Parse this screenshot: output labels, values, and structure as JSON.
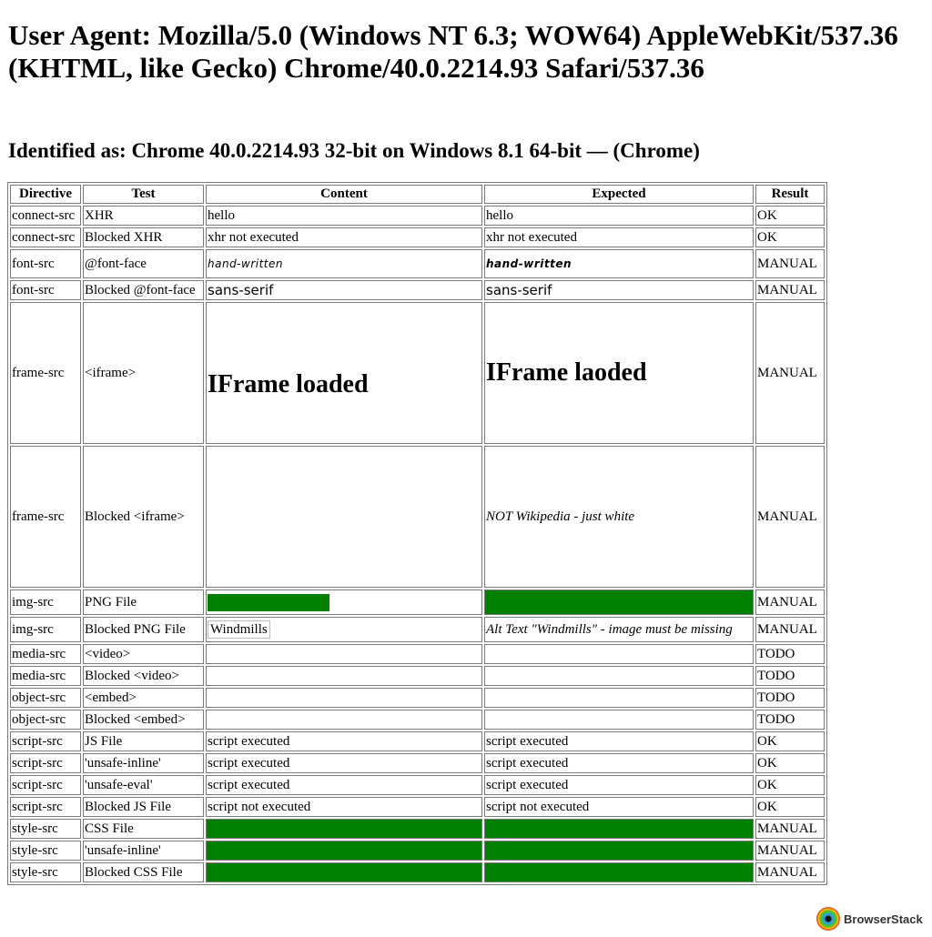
{
  "header": {
    "user_agent": "User Agent: Mozilla/5.0 (Windows NT 6.3; WOW64) AppleWebKit/537.36 (KHTML, like Gecko) Chrome/40.0.2214.93 Safari/537.36",
    "identified": "Identified as: Chrome 40.0.2214.93 32-bit on Windows 8.1 64-bit — (Chrome)"
  },
  "table": {
    "columns": [
      "Directive",
      "Test",
      "Content",
      "Expected",
      "Result"
    ],
    "rows": [
      {
        "directive": "connect-src",
        "test": "XHR",
        "content": "hello",
        "expected": "hello",
        "result": "OK"
      },
      {
        "directive": "connect-src",
        "test": "Blocked XHR",
        "content": "xhr not executed",
        "expected": "xhr not executed",
        "result": "OK"
      },
      {
        "directive": "font-src",
        "test": "@font-face",
        "content": "hand-written",
        "expected": "hand-written",
        "result": "MANUAL"
      },
      {
        "directive": "font-src",
        "test": "Blocked @font-face",
        "content": "sans-serif",
        "expected": "sans-serif",
        "result": "MANUAL"
      },
      {
        "directive": "frame-src",
        "test": "<iframe>",
        "content": "IFrame loaded",
        "expected": "IFrame laoded",
        "result": "MANUAL"
      },
      {
        "directive": "frame-src",
        "test": "Blocked <iframe>",
        "content": "",
        "expected": "NOT Wikipedia - just white",
        "result": "MANUAL"
      },
      {
        "directive": "img-src",
        "test": "PNG File",
        "content": "",
        "expected": "",
        "result": "MANUAL"
      },
      {
        "directive": "img-src",
        "test": "Blocked PNG File",
        "content": "Windmills",
        "expected": "Alt Text \"Windmills\" - image must be missing",
        "result": "MANUAL"
      },
      {
        "directive": "media-src",
        "test": "<video>",
        "content": "",
        "expected": "",
        "result": "TODO"
      },
      {
        "directive": "media-src",
        "test": "Blocked <video>",
        "content": "",
        "expected": "",
        "result": "TODO"
      },
      {
        "directive": "object-src",
        "test": "<embed>",
        "content": "",
        "expected": "",
        "result": "TODO"
      },
      {
        "directive": "object-src",
        "test": "Blocked <embed>",
        "content": "",
        "expected": "",
        "result": "TODO"
      },
      {
        "directive": "script-src",
        "test": "JS File",
        "content": "script executed",
        "expected": "script executed",
        "result": "OK"
      },
      {
        "directive": "script-src",
        "test": "'unsafe-inline'",
        "content": "script executed",
        "expected": "script executed",
        "result": "OK"
      },
      {
        "directive": "script-src",
        "test": "'unsafe-eval'",
        "content": "script executed",
        "expected": "script executed",
        "result": "OK"
      },
      {
        "directive": "script-src",
        "test": "Blocked JS File",
        "content": "script not executed",
        "expected": "script not executed",
        "result": "OK"
      },
      {
        "directive": "style-src",
        "test": "CSS File",
        "content": "",
        "expected": "",
        "result": "MANUAL"
      },
      {
        "directive": "style-src",
        "test": "'unsafe-inline'",
        "content": "",
        "expected": "",
        "result": "MANUAL"
      },
      {
        "directive": "style-src",
        "test": "Blocked CSS File",
        "content": "",
        "expected": "",
        "result": "MANUAL"
      }
    ]
  },
  "colors": {
    "pass_fill": "#008000",
    "border": "#7a7a7a"
  },
  "badge": {
    "label": "BrowserStack",
    "icon": "browserstack-logo-icon"
  }
}
